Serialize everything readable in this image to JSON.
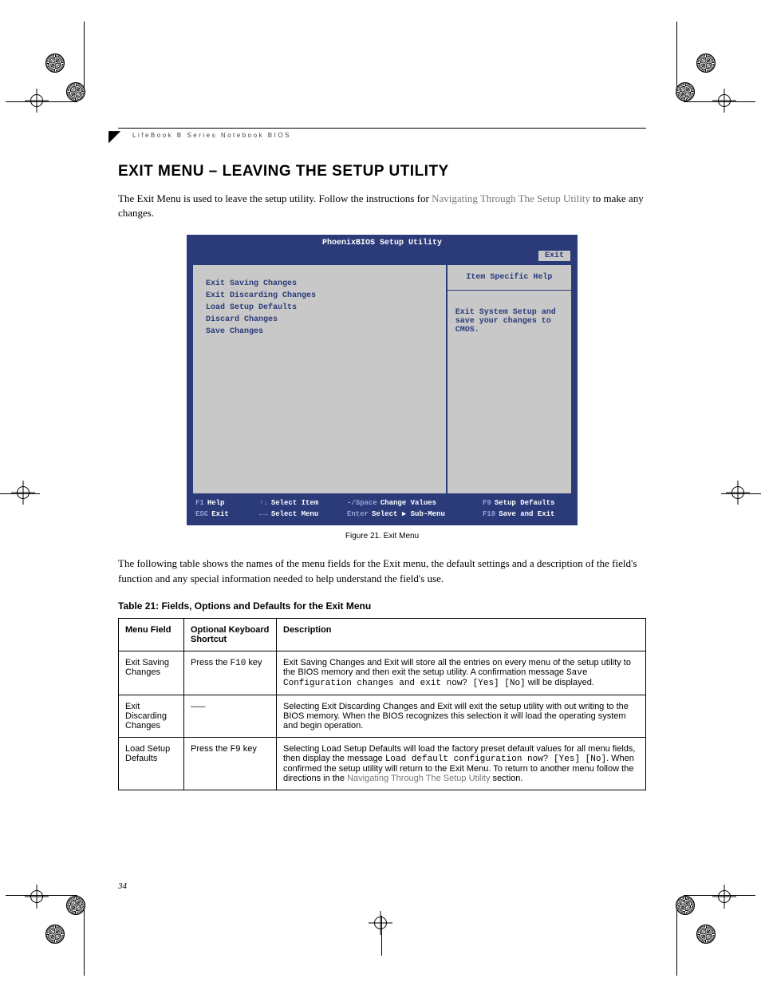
{
  "header": {
    "label": "LifeBook B Series Notebook BIOS"
  },
  "heading": "EXIT MENU – LEAVING THE SETUP UTILITY",
  "intro": {
    "part1": "The Exit Menu is used to leave the setup utility. Follow the instructions for ",
    "link": "Navigating Through The Setup Utility",
    "part2": " to make any changes."
  },
  "bios": {
    "title": "PhoenixBIOS Setup Utility",
    "active_tab": "Exit",
    "menu_items": [
      "Exit Saving Changes",
      "Exit Discarding Changes",
      "Load Setup Defaults",
      "Discard Changes",
      "Save Changes"
    ],
    "help_header": "Item Specific Help",
    "help_body": "Exit System Setup and save your changes to CMOS.",
    "footer": {
      "f1": "Help",
      "esc": "Exit",
      "updown": "Select Item",
      "leftright": "Select Menu",
      "minus": "Change Values",
      "enter": "Select ▶ Sub-Menu",
      "f9": "Setup Defaults",
      "f10": "Save and Exit"
    }
  },
  "figure_caption": "Figure 21.  Exit Menu",
  "after_figure": "The following table shows the names of the menu fields for the Exit menu, the default settings and a description of the field's function and any special information needed to help understand the field's use.",
  "table_title": "Table 21: Fields, Options and Defaults for the Exit Menu",
  "table": {
    "headers": {
      "c1": "Menu Field",
      "c2": "Optional Keyboard Shortcut",
      "c3": "Description"
    },
    "rows": [
      {
        "field": "Exit Saving Changes",
        "shortcut_prefix": "Press the ",
        "shortcut_key": "F10",
        "shortcut_suffix": " key",
        "desc_1": "Exit Saving Changes and Exit will store all the entries on every menu of the setup utility to the BIOS memory and then exit the setup utility. A confirmation message ",
        "desc_mono": "Save Configuration changes and exit now? [Yes] [No]",
        "desc_2": " will be displayed."
      },
      {
        "field": "Exit Discarding Changes",
        "shortcut_plain": "–––",
        "desc_plain": "Selecting Exit Discarding Changes and Exit will exit the setup utility with out writing to the BIOS memory. When the BIOS recognizes this selection it will load the operating system and begin operation."
      },
      {
        "field": "Load Setup Defaults",
        "shortcut_prefix": "Press the ",
        "shortcut_key": "F9",
        "shortcut_suffix": " key",
        "desc_1": "Selecting Load Setup Defaults will load the factory preset default values for all menu fields, then display the message ",
        "desc_mono": "Load default configuration now? [Yes] [No]",
        "desc_2": ". When confirmed the setup utility will return to the Exit Menu. To return to another menu follow the directions in the ",
        "desc_link": "Navigating Through The Setup Utility",
        "desc_3": " section."
      }
    ]
  },
  "page_number": "34"
}
